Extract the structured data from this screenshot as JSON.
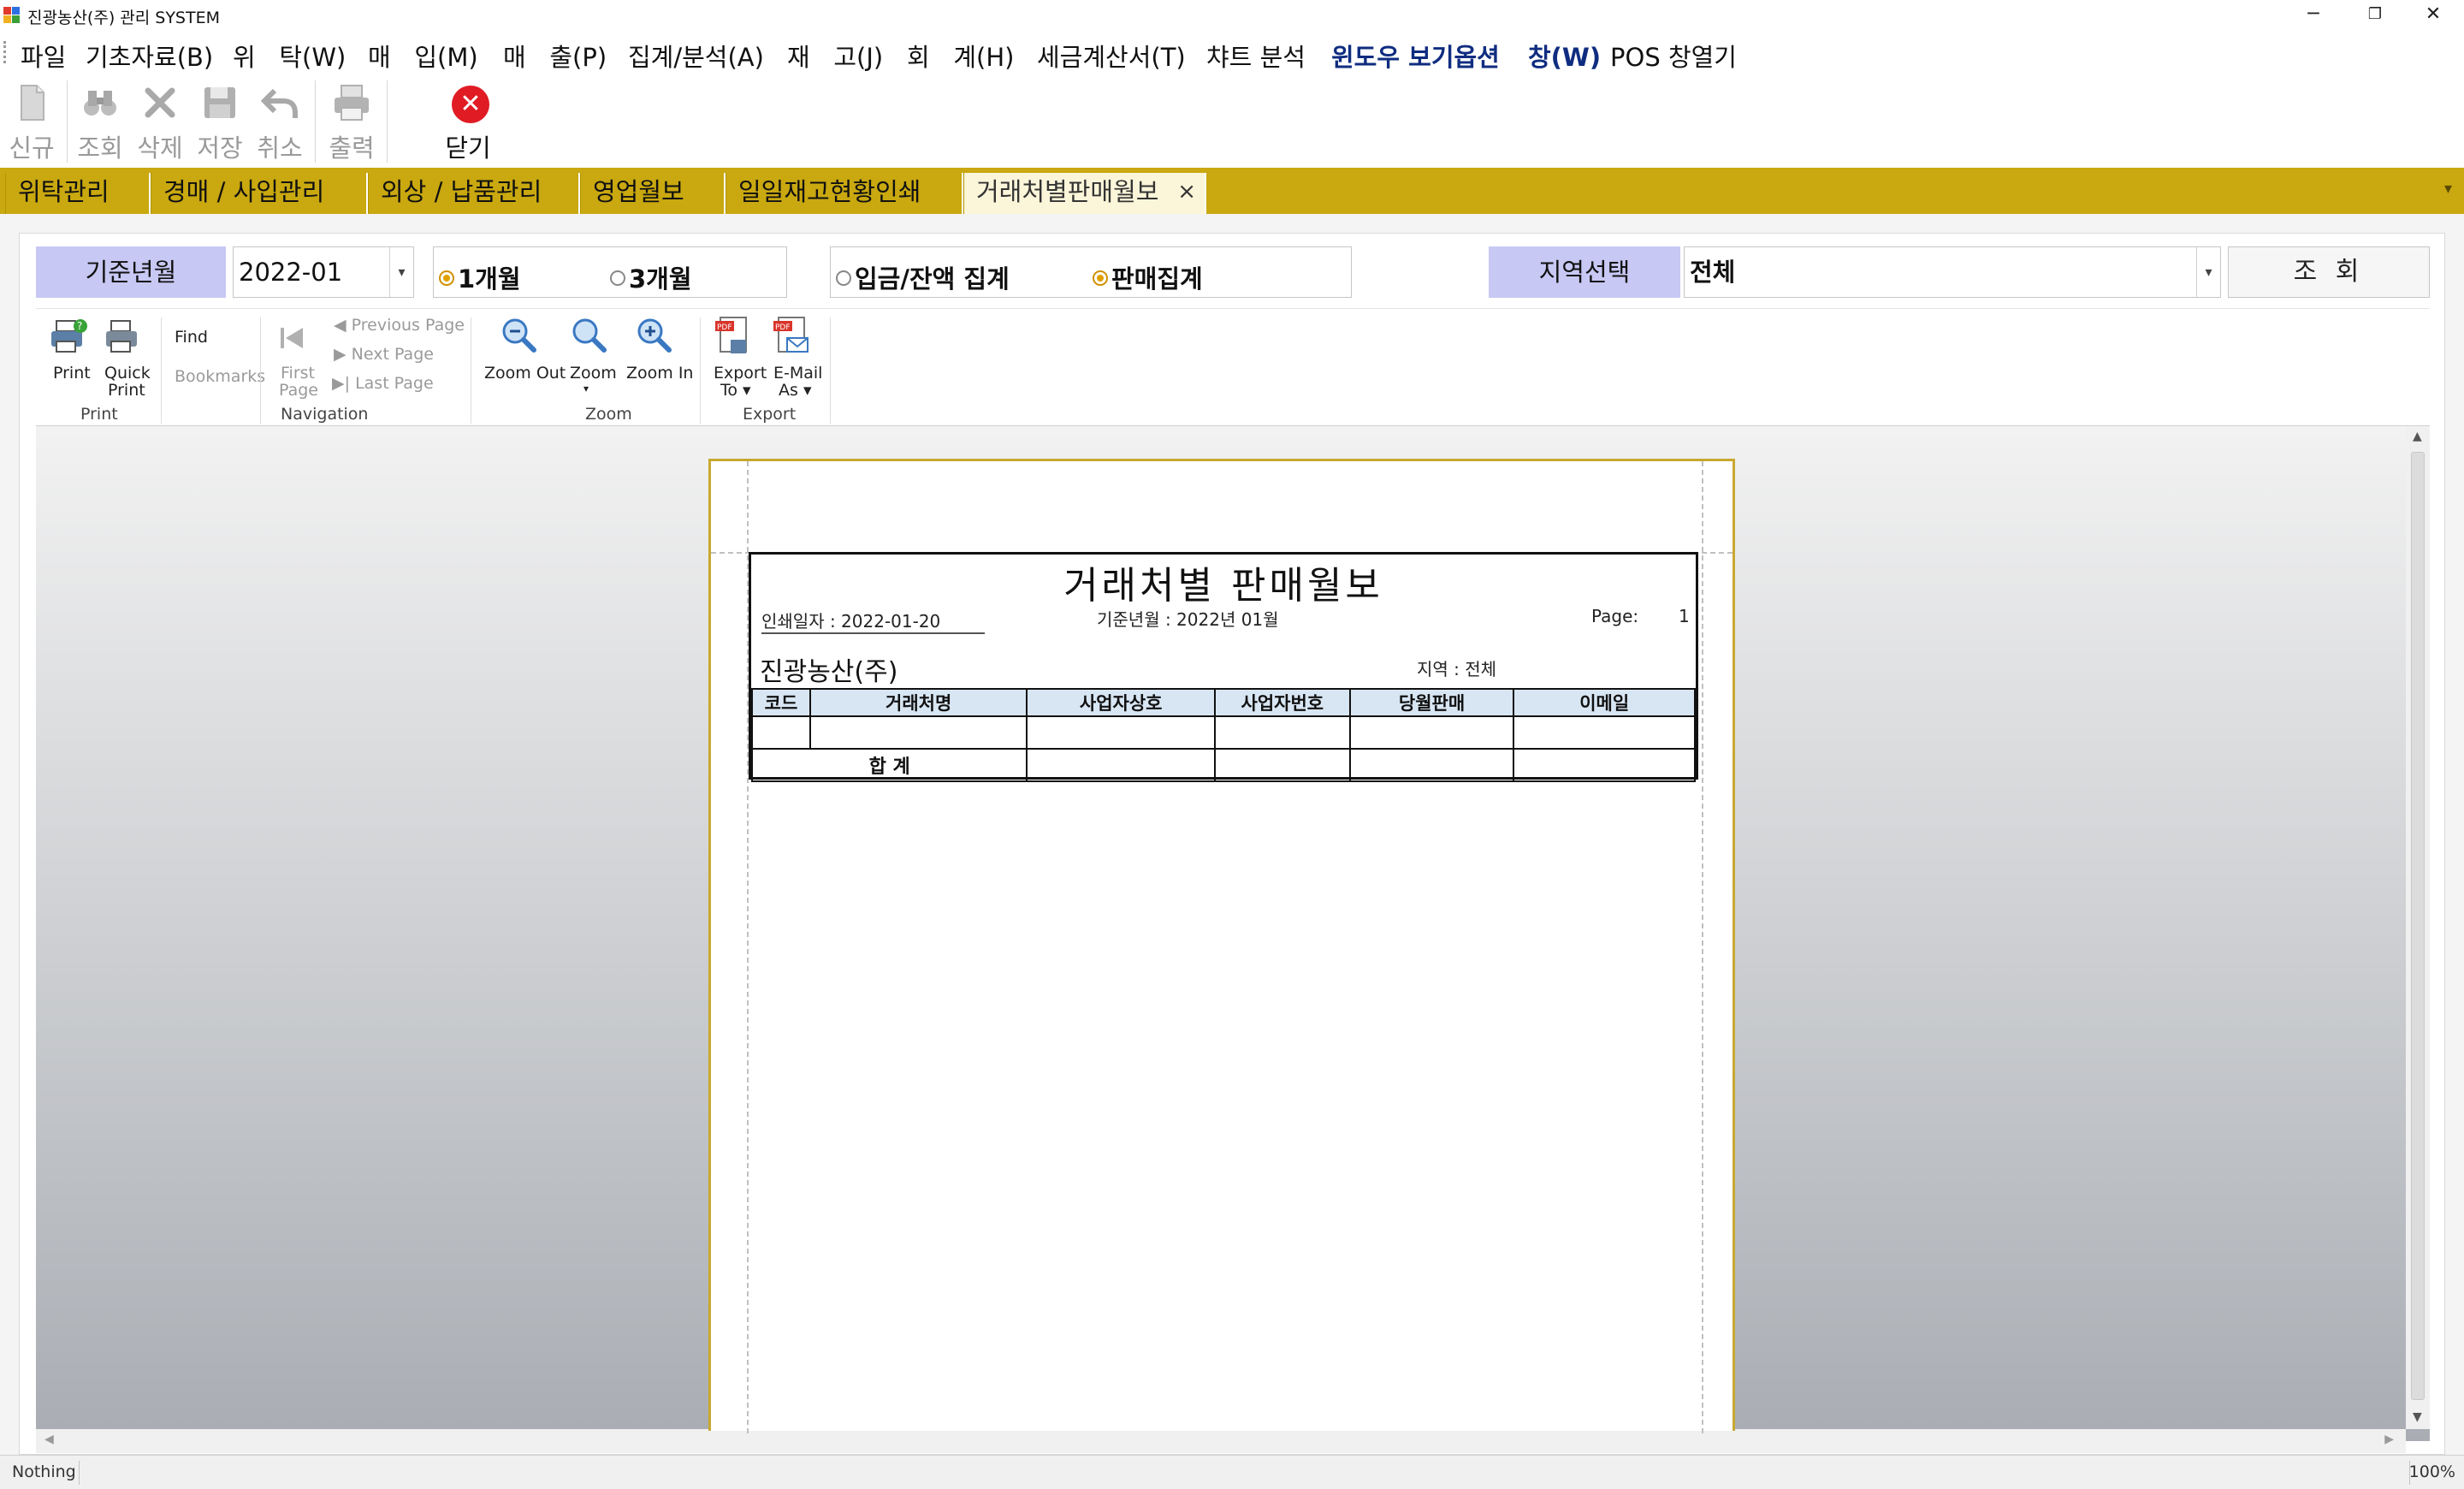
{
  "window": {
    "title": "진광농산(주) 관리 SYSTEM",
    "minimize": "─",
    "restore": "❐",
    "close": "✕"
  },
  "menu": {
    "items": [
      "파일",
      "기초자료(B)",
      "위   탁(W)",
      "매   입(M)",
      "매   출(P)",
      "집계/분석(A)",
      "재   고(J)",
      "회   계(H)",
      "세금계산서(T)",
      "챠트 분석",
      "윈도우 보기옵션",
      "창(W)",
      "POS 창열기"
    ]
  },
  "toolbar": {
    "new": "신규",
    "search": "조회",
    "delete": "삭제",
    "save": "저장",
    "cancel": "취소",
    "print": "출력",
    "close": "닫기"
  },
  "tabs": [
    "위탁관리",
    "경매 / 사입관리",
    "외상 / 납품관리",
    "영업월보",
    "일일재고현황인쇄",
    "거래처별판매월보"
  ],
  "filters": {
    "month_label": "기준년월",
    "month_value": "2022-01",
    "period_1": "1개월",
    "period_3": "3개월",
    "agg_deposit": "입금/잔액 집계",
    "agg_sales": "판매집계",
    "region_label": "지역선택",
    "region_value": "전체",
    "search_button": "조 회"
  },
  "ribbon": {
    "print": "Print",
    "quick_print_1": "Quick",
    "quick_print_2": "Print",
    "find": "Find",
    "bookmarks": "Bookmarks",
    "first_page_1": "First",
    "first_page_2": "Page",
    "previous_page": "Previous Page",
    "next_page": "Next  Page",
    "last_page": "Last  Page",
    "zoom_out": "Zoom Out",
    "zoom": "Zoom",
    "zoom_in": "Zoom In",
    "export_1": "Export",
    "export_2": "To",
    "email_1": "E-Mail",
    "email_2": "As",
    "group_print": "Print",
    "group_navigation": "Navigation",
    "group_zoom": "Zoom",
    "group_export": "Export"
  },
  "report": {
    "title": "거래처별 판매월보",
    "print_date": "인쇄일자 : 2022-01-20",
    "base_month": "기준년월 : 2022년 01월",
    "page_label": "Page:",
    "page_num": "1",
    "company": "진광농산(주)",
    "region": "지역 : 전체",
    "columns": [
      "코드",
      "거래처명",
      "사업자상호",
      "사업자번호",
      "당월판매",
      "이메일"
    ],
    "total_label": "합   계"
  },
  "status": {
    "left": "Nothing",
    "zoom": "100%"
  }
}
